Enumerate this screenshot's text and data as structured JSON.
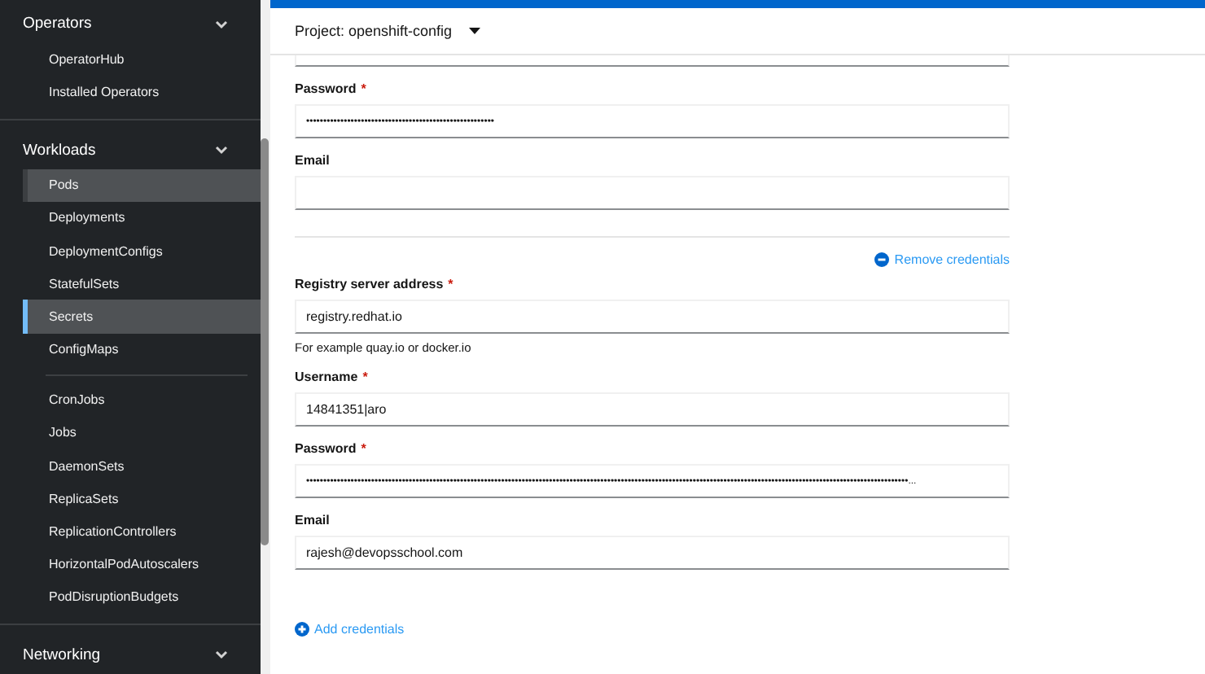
{
  "sidebar": {
    "sections": [
      {
        "title": "Operators",
        "expanded": true,
        "groups": [
          [
            {
              "label": "OperatorHub",
              "selected": false,
              "hovered": false
            },
            {
              "label": "Installed Operators",
              "selected": false,
              "hovered": false
            }
          ]
        ]
      },
      {
        "title": "Workloads",
        "expanded": true,
        "groups": [
          [
            {
              "label": "Pods",
              "selected": false,
              "hovered": true
            },
            {
              "label": "Deployments",
              "selected": false,
              "hovered": false
            },
            {
              "label": "DeploymentConfigs",
              "selected": false,
              "hovered": false
            },
            {
              "label": "StatefulSets",
              "selected": false,
              "hovered": false
            },
            {
              "label": "Secrets",
              "selected": true,
              "hovered": false
            },
            {
              "label": "ConfigMaps",
              "selected": false,
              "hovered": false
            }
          ],
          [
            {
              "label": "CronJobs",
              "selected": false,
              "hovered": false
            },
            {
              "label": "Jobs",
              "selected": false,
              "hovered": false
            },
            {
              "label": "DaemonSets",
              "selected": false,
              "hovered": false
            },
            {
              "label": "ReplicaSets",
              "selected": false,
              "hovered": false
            },
            {
              "label": "ReplicationControllers",
              "selected": false,
              "hovered": false
            },
            {
              "label": "HorizontalPodAutoscalers",
              "selected": false,
              "hovered": false
            },
            {
              "label": "PodDisruptionBudgets",
              "selected": false,
              "hovered": false
            }
          ]
        ]
      },
      {
        "title": "Networking",
        "expanded": true
      }
    ]
  },
  "required_mark": "*",
  "project_bar": {
    "label": "Project: openshift-config"
  },
  "credentials": [
    {
      "fields": [
        {
          "kind": "password",
          "label": "Password",
          "required": true,
          "value": "•••••••••••••••••••••••••••••••••••••••••••••••••••••••"
        },
        {
          "kind": "text",
          "label": "Email",
          "required": false
        }
      ]
    },
    {
      "remove_label": "Remove credentials",
      "fields": [
        {
          "kind": "text",
          "label": "Registry server address",
          "required": true,
          "value": "registry.redhat.io",
          "helper": "For example quay.io or docker.io"
        },
        {
          "kind": "text",
          "label": "Username",
          "required": true,
          "value": "14841351|aro"
        },
        {
          "kind": "password",
          "label": "Password",
          "required": true,
          "value": "••••••••••••••••••••••••••••••••••••••••••••••••••••••••••••••••••••••••••••••••••••••••••••••••••••••••••••••••••••••••••••••••••••••••••••••••••••••••••••••••••••••••••••••••..."
        },
        {
          "kind": "text",
          "label": "Email",
          "required": false,
          "value": "rajesh@devopsschool.com"
        }
      ]
    }
  ],
  "add_label": "Add credentials"
}
